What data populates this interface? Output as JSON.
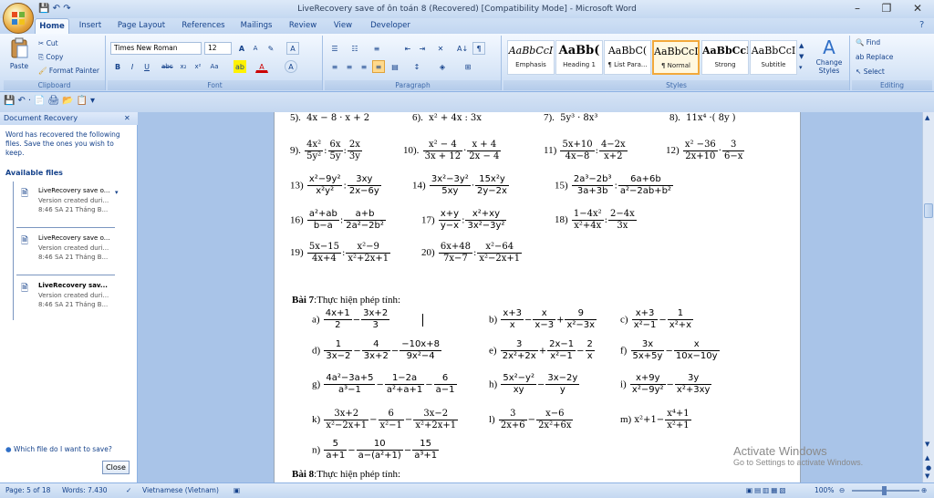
{
  "window": {
    "title": "LiveRecovery save of ôn toán 8 (Recovered) [Compatibility Mode] - Microsoft Word",
    "min": "–",
    "max": "❐",
    "close": "✕"
  },
  "tabs": [
    "Home",
    "Insert",
    "Page Layout",
    "References",
    "Mailings",
    "Review",
    "View",
    "Developer"
  ],
  "clipboard": {
    "paste": "Paste",
    "cut": "Cut",
    "copy": "Copy",
    "format_painter": "Format Painter",
    "label": "Clipboard"
  },
  "font": {
    "family": "Times New Roman",
    "size": "12",
    "label": "Font",
    "bold": "B",
    "italic": "I",
    "underline": "U",
    "strike": "abc",
    "sub": "x₂",
    "sup": "x²",
    "grow": "A",
    "shrink": "A",
    "change_case": "Aa"
  },
  "paragraph": {
    "label": "Paragraph",
    "sort": "A↓",
    "show_marks": "¶"
  },
  "styles": {
    "label": "Styles",
    "change": "Change Styles",
    "items": [
      {
        "sample": "AaBbCcI",
        "name": "Emphasis"
      },
      {
        "sample": "AaBb(",
        "name": "Heading 1"
      },
      {
        "sample": "AaBbC(",
        "name": "¶ List Para..."
      },
      {
        "sample": "AaBbCcI",
        "name": "¶ Normal"
      },
      {
        "sample": "AaBbCcI",
        "name": "Strong"
      },
      {
        "sample": "AaBbCcI",
        "name": "Subtitle"
      }
    ]
  },
  "editing": {
    "label": "Editing",
    "find": "Find",
    "replace": "Replace",
    "select": "Select"
  },
  "recovery": {
    "title": "Document Recovery",
    "desc": "Word has recovered the following files. Save the ones you wish to keep.",
    "available": "Available files",
    "files": [
      {
        "name": "LiveRecovery save o...",
        "sub1": "Version created duri...",
        "sub2": "8:46 SA 21 Tháng B..."
      },
      {
        "name": "LiveRecovery save o...",
        "sub1": "Version created duri...",
        "sub2": "8:46 SA 21 Tháng B..."
      },
      {
        "name": "LiveRecovery sav...",
        "sub1": "Version created duri...",
        "sub2": "8:46 SA 21 Tháng B..."
      }
    ],
    "help": "Which file do I want to save?",
    "close": "Close"
  },
  "doc": {
    "bai7": "Bài 7",
    "bai7_text": ":Thực hiện phép tính:",
    "bai8": "Bài 8",
    "bai8_text": ":Thực hiện phép tính:"
  },
  "status": {
    "page": "Page: 5 of 18",
    "words": "Words: 7.430",
    "lang": "Vietnamese (Vietnam)",
    "zoom": "100%"
  },
  "watermark": {
    "line1": "Activate Windows",
    "line2": "Go to Settings to activate Windows."
  }
}
